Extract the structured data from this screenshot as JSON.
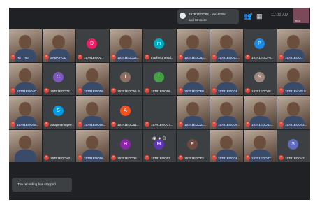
{
  "presenter": {
    "line1": "197R1EOO84 - MAHESH...",
    "line2": "and 63 more"
  },
  "header": {
    "people_count": "3",
    "time": "11:09 AM",
    "self_label": "You"
  },
  "colors": {
    "background": "#202124",
    "tile": "#3c4043",
    "muted_mic": "#ea4335"
  },
  "toast": "The recording has stopped",
  "tiles": [
    {
      "name": "Ha . You",
      "photo": true
    },
    {
      "name": "SABA-HOD",
      "photo": true
    },
    {
      "name": "197R1EOO0...",
      "letter": "D",
      "color": "#e91e63"
    },
    {
      "name": "197R1EOO13...",
      "photo": true
    },
    {
      "name": "mudhingi anud...",
      "letter": "m",
      "color": "#00acc1"
    },
    {
      "name": "197R1EOO93...",
      "photo": true
    },
    {
      "name": "197R1EOOC7...",
      "photo": true
    },
    {
      "name": "197R1EOOF0...",
      "letter": "P",
      "color": "#1e88e5"
    },
    {
      "name": "197R1EOO...",
      "photo": true
    },
    {
      "name": "197R1EOO40...",
      "photo": true
    },
    {
      "name": "197R1EOO73...",
      "letter": "C",
      "color": "#7e57c2"
    },
    {
      "name": "197R1EOO59...",
      "photo": true
    },
    {
      "name": "197R1EOO56 P...",
      "letter": "I",
      "color": "#8d6e63"
    },
    {
      "name": "197R1EOO89...",
      "letter": "T",
      "color": "#43a047"
    },
    {
      "name": "197R1EOOF0...",
      "photo": true
    },
    {
      "name": "197R1EOO14...",
      "photo": true
    },
    {
      "name": "197R1EOO08...",
      "letter": "S",
      "color": "#a1887f"
    },
    {
      "name": "197R1Eoo78 S...",
      "photo": true
    },
    {
      "name": "197R1EOO49...",
      "photo": true
    },
    {
      "name": "Swaprnamayee...",
      "letter": "S",
      "color": "#039be5"
    },
    {
      "name": "197R1EOO88...",
      "photo": true
    },
    {
      "name": "197R1EOO61...",
      "letter": "A",
      "color": "#f4511e"
    },
    {
      "name": "197R1EOO17...",
      "letter": "",
      "color": "#3c4043"
    },
    {
      "name": "197R1EOO22...",
      "photo": true
    },
    {
      "name": "197R1EOO79...",
      "photo": true
    },
    {
      "name": "197R1EOO83...",
      "photo": true
    },
    {
      "name": "197R1EOO43...",
      "photo": true
    },
    {
      "name": "",
      "photo": true
    },
    {
      "name": "197R1EOOA0...",
      "letter": "",
      "color": "#3c4043"
    },
    {
      "name": "197R1EOO66...",
      "photo": true
    },
    {
      "name": "197R1EOO36...",
      "letter": "H",
      "color": "#8e24aa"
    },
    {
      "name": "197R1EOO53...",
      "letter": "M",
      "color": "#5e35b1"
    },
    {
      "name": "197R1EOOF2...",
      "letter": "P",
      "color": "#6d4c41"
    },
    {
      "name": "197R1EOO74...",
      "photo": true
    },
    {
      "name": "197R1EOO47...",
      "photo": true
    },
    {
      "name": "197R1EOO43...",
      "letter": "S",
      "color": "#5c6bc0"
    }
  ]
}
